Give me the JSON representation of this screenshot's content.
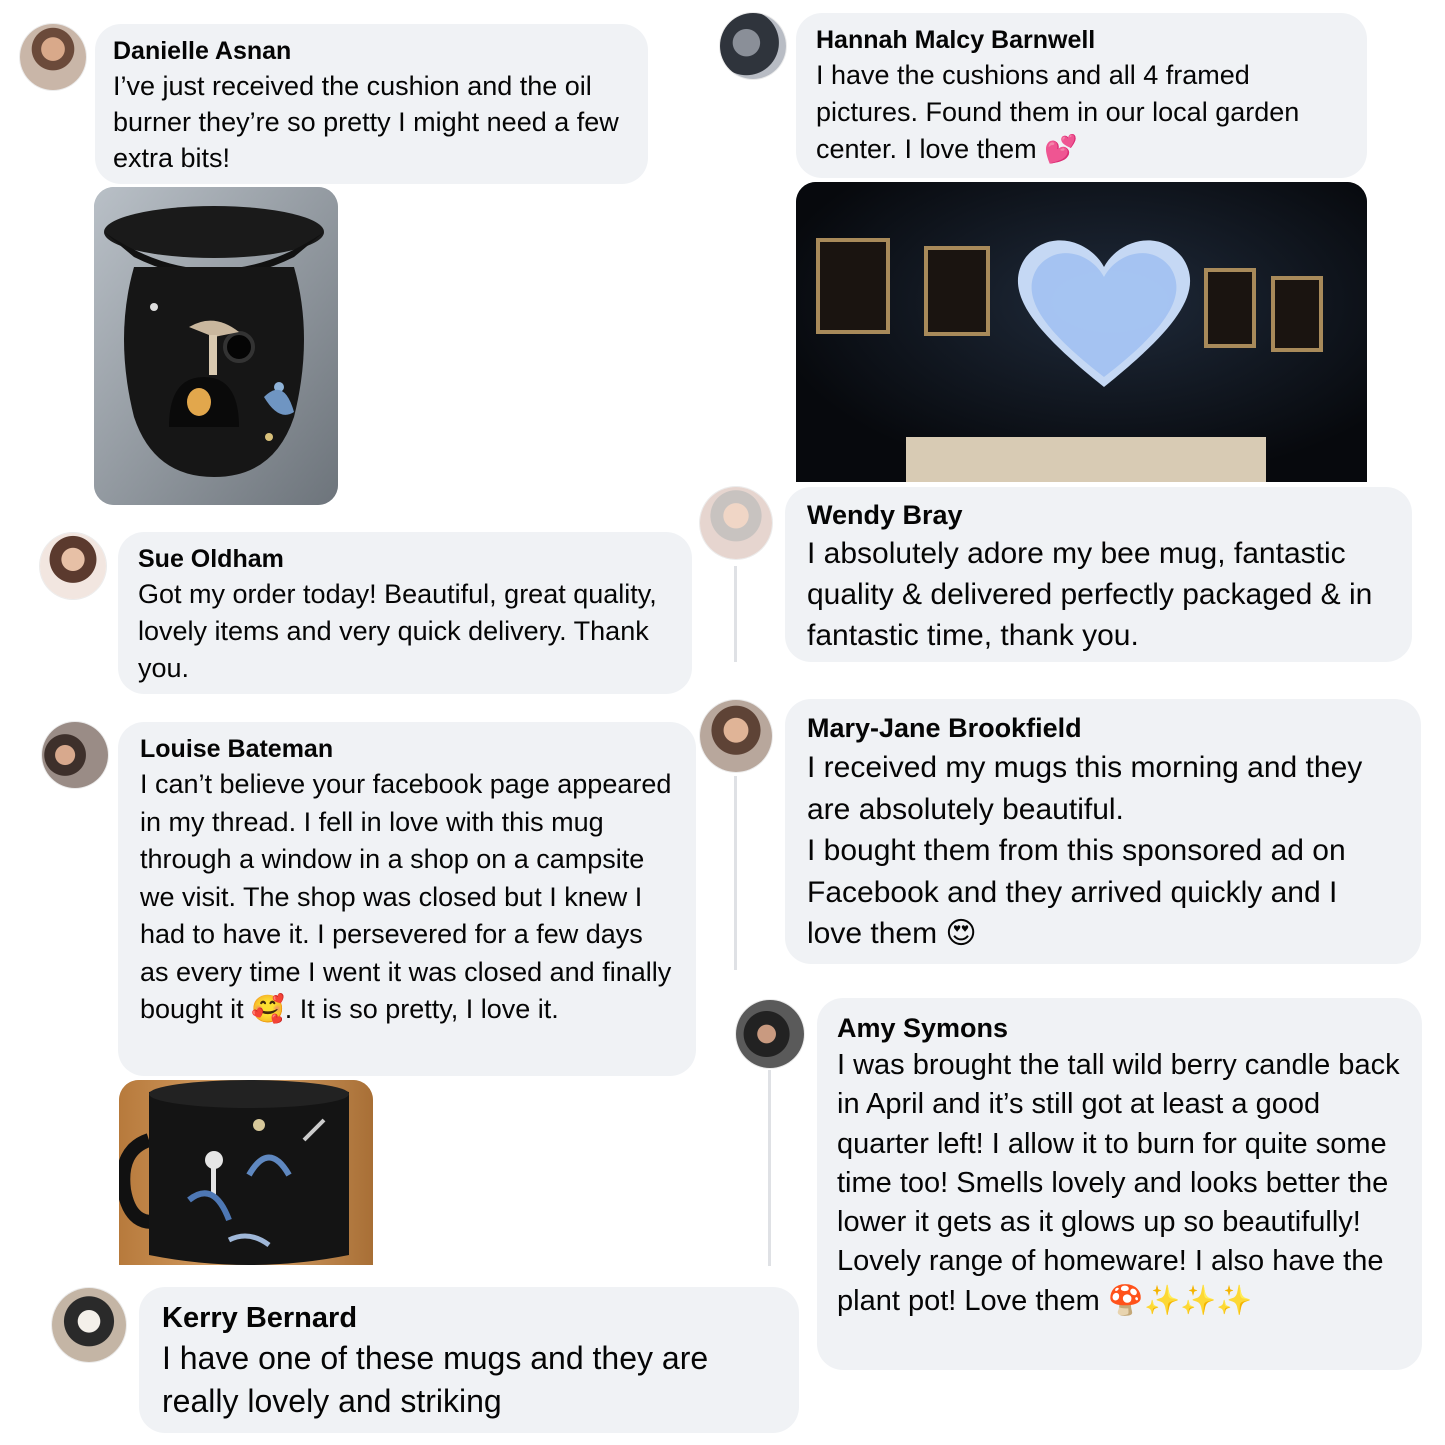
{
  "comments": [
    {
      "name": "Danielle Asnan",
      "text": "I’ve just received the cushion and the oil burner they’re so pretty I might need a few extra bits!",
      "image": "black oil burner with mushroom print"
    },
    {
      "name": "Hannah Malcy Barnwell",
      "text": "I have the cushions and all 4 framed pictures. Found them in our local garden center. I love them 💕",
      "image": "framed pictures and light-up heart on dark wall"
    },
    {
      "name": "Sue Oldham",
      "text": "Got my order today! Beautiful, great quality, lovely items and very quick delivery. Thank you."
    },
    {
      "name": "Wendy Bray",
      "text": "I absolutely adore my bee mug, fantastic quality & delivered  perfectly packaged & in fantastic time, thank you."
    },
    {
      "name": "Louise Bateman",
      "text": "I can’t believe your facebook page appeared in my thread. I fell in love with this mug through a window in a shop on a campsite we visit. The shop was closed but I knew I had to have it. I persevered for a few days as every time I went it was closed and finally bought it 🥰. It is so pretty, I love it.",
      "image": "black mug with botanical print"
    },
    {
      "name": "Mary-Jane Brookfield",
      "text": "I received my mugs this morning and they are absolutely beautiful.\n  I bought them from this sponsored ad on Facebook and they arrived quickly and I love them 😍"
    },
    {
      "name": "Amy Symons",
      "text": "I was brought the tall wild berry  candle back in April and it’s still got at least a good quarter left! I allow it to burn for quite some time too! Smells lovely and looks better the lower it gets as it glows up so beautifully! Lovely range of homeware! I also have the plant pot! Love them 🍄✨✨✨"
    },
    {
      "name": "Kerry Bernard",
      "text": "I have one of these mugs and they are really lovely and striking"
    }
  ]
}
